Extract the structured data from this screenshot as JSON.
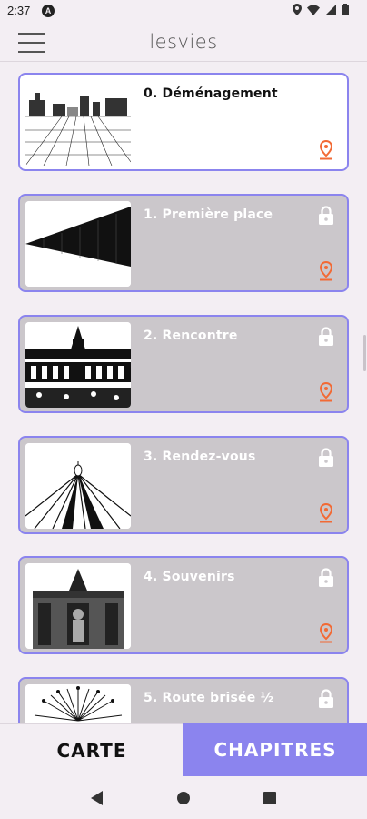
{
  "status": {
    "time": "2:37",
    "badge": "A"
  },
  "appbar": {
    "title": "lesvies"
  },
  "chapters": [
    {
      "title": "0. Déménagement",
      "locked": false
    },
    {
      "title": "1. Première place",
      "locked": true
    },
    {
      "title": "2. Rencontre",
      "locked": true
    },
    {
      "title": "3. Rendez-vous",
      "locked": true
    },
    {
      "title": "4. Souvenirs",
      "locked": true
    },
    {
      "title": "5. Route brisée ½",
      "locked": true
    }
  ],
  "tabs": {
    "carte": "CARTE",
    "chapitres": "CHAPITRES",
    "active": "chapitres"
  },
  "colors": {
    "accent": "#8b84ee",
    "pin": "#f26a35",
    "locked_bg": "#cbc7cb"
  }
}
